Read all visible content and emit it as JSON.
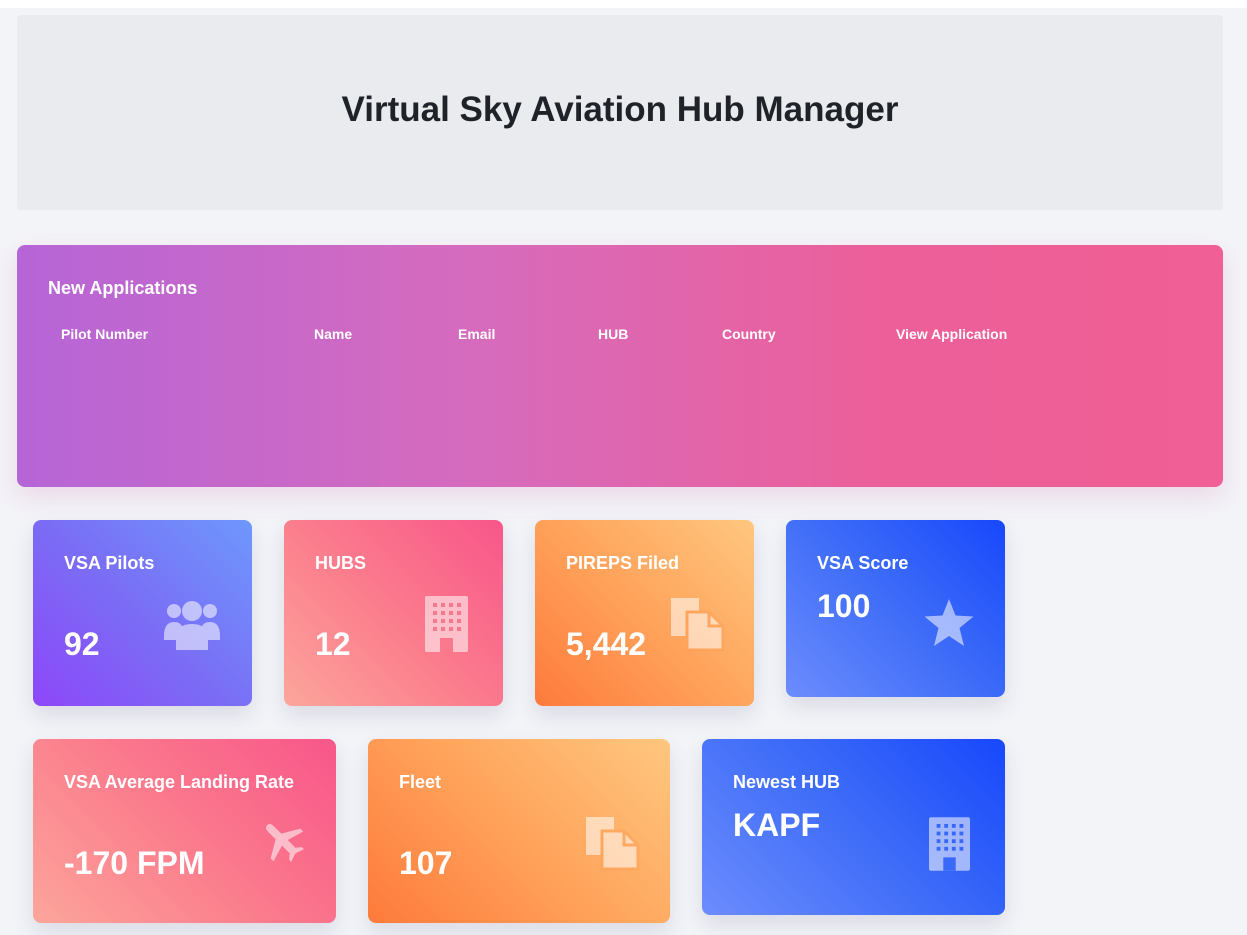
{
  "page": {
    "title": "Virtual Sky Aviation Hub Manager"
  },
  "applications": {
    "title": "New Applications",
    "columns": [
      "Pilot Number",
      "Name",
      "Email",
      "HUB",
      "Country",
      "View Application"
    ]
  },
  "stats": [
    {
      "label": "VSA Pilots",
      "value": "92",
      "icon": "users-icon"
    },
    {
      "label": "HUBS",
      "value": "12",
      "icon": "building-icon"
    },
    {
      "label": "PIREPS Filed",
      "value": "5,442",
      "icon": "copy-icon"
    },
    {
      "label": "VSA Score",
      "value": "100",
      "icon": "star-icon"
    },
    {
      "label": "VSA Average Landing Rate",
      "value": "-170 FPM",
      "icon": "plane-icon"
    },
    {
      "label": "Fleet",
      "value": "107",
      "icon": "copy-icon"
    },
    {
      "label": "Newest HUB",
      "value": "KAPF",
      "icon": "building-icon"
    }
  ],
  "colors": {
    "purple": "#8d47f9",
    "pink": "#f8568a",
    "orange": "#fe7a3b",
    "blue": "#1748fb",
    "applications_start": "#b665d7",
    "applications_end": "#f05f95"
  }
}
